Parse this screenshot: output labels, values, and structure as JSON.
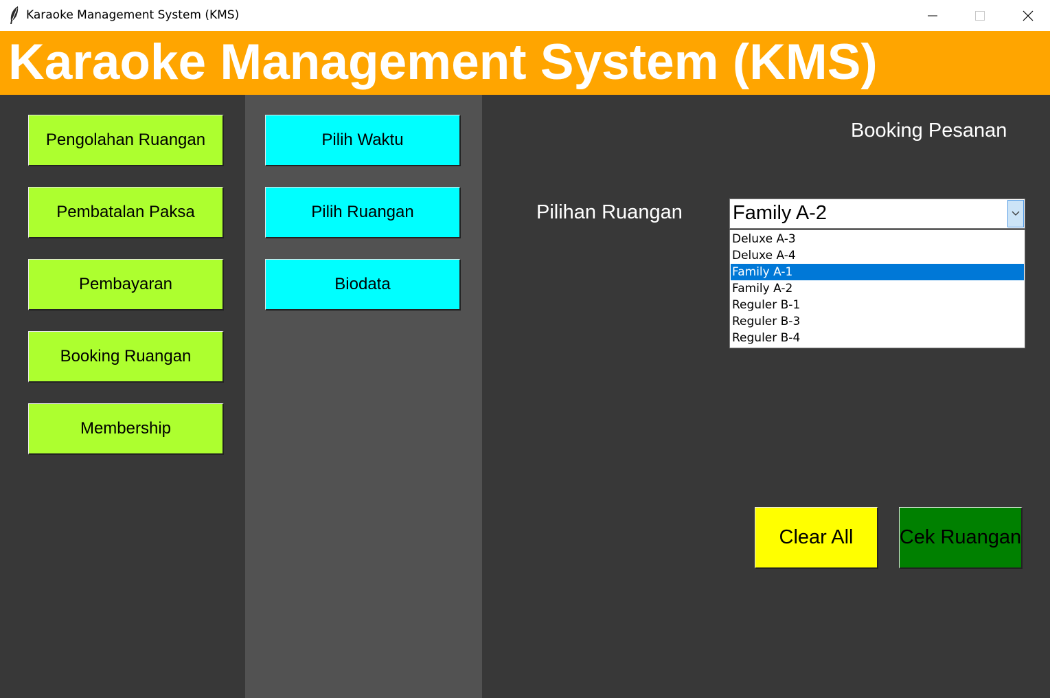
{
  "window": {
    "title": "Karaoke Management System (KMS)"
  },
  "header": {
    "title": "Karaoke Management System (KMS)"
  },
  "left_menu": {
    "items": [
      {
        "label": "Pengolahan Ruangan"
      },
      {
        "label": "Pembatalan Paksa"
      },
      {
        "label": "Pembayaran"
      },
      {
        "label": "Booking Ruangan"
      },
      {
        "label": "Membership"
      }
    ]
  },
  "sub_menu": {
    "items": [
      {
        "label": "Pilih Waktu"
      },
      {
        "label": "Pilih Ruangan"
      },
      {
        "label": "Biodata"
      }
    ]
  },
  "booking": {
    "title": "Booking Pesanan",
    "field_label": "Pilihan Ruangan",
    "selected_value": "Family A-2",
    "options": [
      {
        "label": "Deluxe A-3",
        "highlighted": false
      },
      {
        "label": "Deluxe A-4",
        "highlighted": false
      },
      {
        "label": "Family A-1",
        "highlighted": true
      },
      {
        "label": "Family A-2",
        "highlighted": false
      },
      {
        "label": "Reguler B-1",
        "highlighted": false
      },
      {
        "label": "Reguler B-3",
        "highlighted": false
      },
      {
        "label": "Reguler B-4",
        "highlighted": false
      }
    ],
    "clear_label": "Clear All",
    "check_label": "Cek Ruangan"
  },
  "colors": {
    "header_bg": "#ffa500",
    "menu_green": "#adff2f",
    "menu_cyan": "#00ffff",
    "clear_yellow": "#ffff00",
    "check_green": "#008000",
    "selection_blue": "#0078d7"
  }
}
